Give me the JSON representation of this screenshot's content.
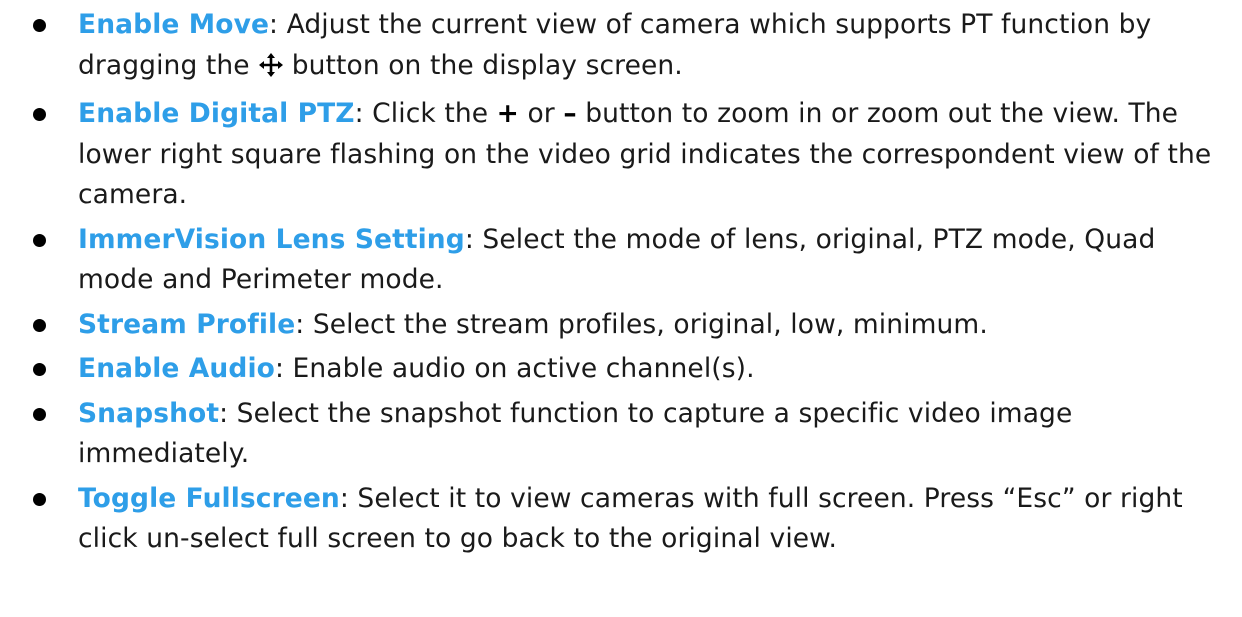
{
  "items": [
    {
      "term": "Enable Move",
      "sep": ":",
      "text_before": " Adjust the current view of camera which supports PT function by dragging the",
      "icon": "move-arrows-icon",
      "text_after": "button on the display screen."
    },
    {
      "term": "Enable Digital PTZ",
      "sep": ":",
      "text_a": " Click the ",
      "plus": "+",
      "text_b": " or ",
      "minus": "–",
      "text_c": " button to zoom in or zoom out the view. The lower right square flashing on the video grid indicates the correspondent view of the camera."
    },
    {
      "term": "ImmerVision Lens Setting",
      "sep": ":",
      "text": " Select the mode of lens, original, PTZ mode, Quad mode and Perimeter mode."
    },
    {
      "term": "Stream Profile",
      "sep": ":",
      "text": " Select the stream profiles, original, low, minimum."
    },
    {
      "term": "Enable Audio",
      "sep": ":",
      "text": " Enable audio on active channel(s)."
    },
    {
      "term": "Snapshot",
      "sep": ":",
      "text": " Select the snapshot function to capture a specific video image immediately."
    },
    {
      "term": "Toggle Fullscreen",
      "sep": ":",
      "text": " Select it to view cameras with full screen. Press “Esc” or right click un-select full screen to go back to the original view."
    }
  ],
  "colors": {
    "term": "#2e9ee8",
    "body_text": "#1a1a1a",
    "bullet": "#000000"
  }
}
